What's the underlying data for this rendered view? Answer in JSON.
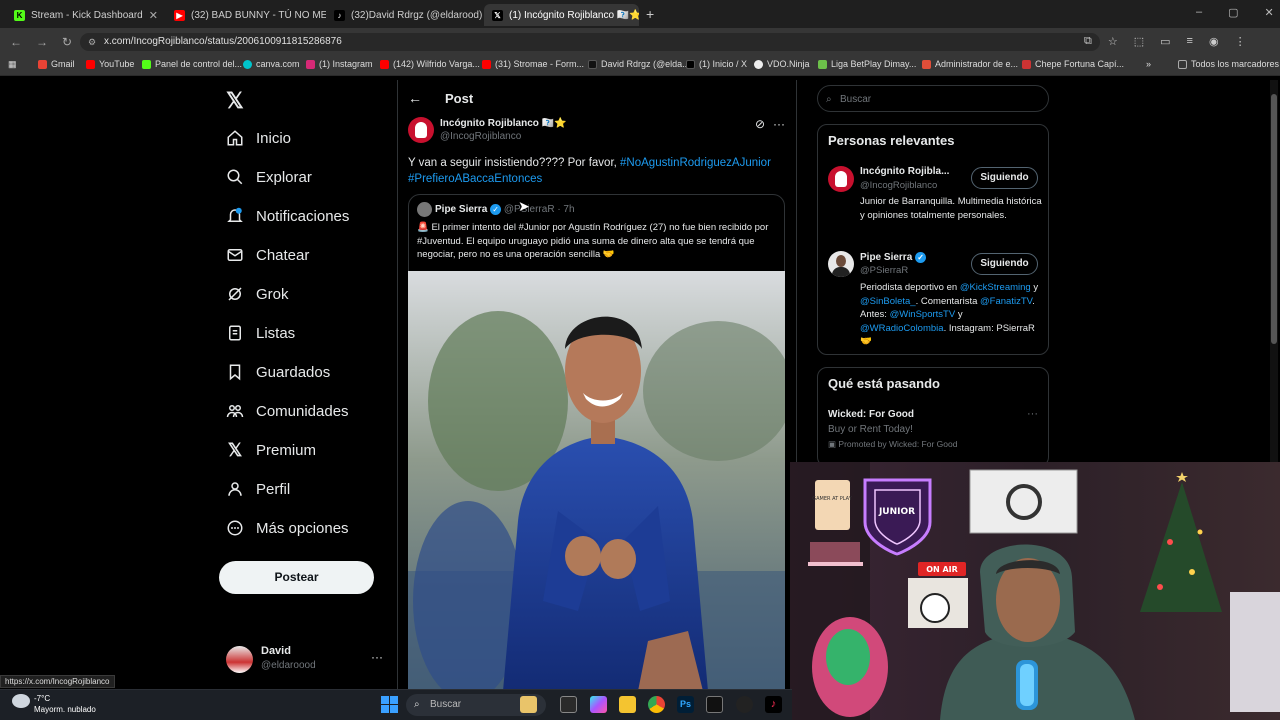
{
  "browser": {
    "tabs": [
      {
        "label": "Stream - Kick Dashboard",
        "icon": "kick-icon",
        "color": "#53fc18"
      },
      {
        "label": "(32) BAD BUNNY - TÚ NO METI",
        "icon": "youtube-icon",
        "color": "#ff0000"
      },
      {
        "label": "(32)David Rdrgz (@eldarood) |",
        "icon": "tiktok-icon",
        "color": "#ffffff"
      },
      {
        "label": "(1) Incógnito Rojiblanco 🇮🇮⭐",
        "icon": "x-icon",
        "color": "#ffffff"
      }
    ],
    "url": "x.com/IncogRojiblanco/status/2006100911815286876",
    "bookmarks": [
      "Gmail",
      "YouTube",
      "Panel de control del...",
      "canva.com",
      "(1) Instagram",
      "(142) Wilfrido Varga...",
      "(31) Stromae - Form...",
      "David Rdrgz (@elda...",
      "(1) Inicio / X",
      "VDO.Ninja",
      "Liga BetPlay Dimay...",
      "Administrador de e...",
      "Chepe Fortuna Capí..."
    ],
    "all_bookmarks": "Todos los marcadores"
  },
  "nav": {
    "items": [
      "Inicio",
      "Explorar",
      "Notificaciones",
      "Chatear",
      "Grok",
      "Listas",
      "Guardados",
      "Comunidades",
      "Premium",
      "Perfil",
      "Más opciones"
    ],
    "post_button": "Postear",
    "account": {
      "name": "David",
      "handle": "@eldaroood"
    }
  },
  "post": {
    "header": "Post",
    "author": "Incógnito Rojiblanco",
    "author_badges": "🇮🇮⭐",
    "handle": "@IncogRojiblanco",
    "text": "Y van a seguir insistiendo???? Por favor, ",
    "hashtag1": "#NoAgustinRodriguezAJunior",
    "hashtag2": "#PrefieroABaccaEntonces",
    "quote": {
      "author": "Pipe Sierra",
      "handle": "@PSierraR",
      "time": "· 7h",
      "text": "🚨 El primer intento del #Junior por Agustín Rodríguez (27) no fue bien recibido por #Juventud. El equipo uruguayo pidió una suma de dinero alta que se tendrá que negociar, pero no es una operación sencilla 🤝"
    }
  },
  "right": {
    "search_placeholder": "Buscar",
    "relevant_title": "Personas relevantes",
    "people": [
      {
        "name": "Incógnito Rojibla...",
        "handle": "@IncogRojiblanco",
        "button": "Siguiendo",
        "bio": "Junior de Barranquilla. Multimedia histórica y opiniones totalmente personales."
      },
      {
        "name": "Pipe Sierra",
        "handle": "@PSierraR",
        "button": "Siguiendo",
        "bio1": "Periodista deportivo en ",
        "bio_l1": "@KickStreaming",
        "bio2": " y ",
        "bio_l2": "@SinBoleta_",
        "bio3": ". Comentarista ",
        "bio_l3": "@FanatizTV",
        "bio4": ". Antes: ",
        "bio_l4": "@WinSportsTV",
        "bio5": " y ",
        "bio_l5": "@WRadioColombia",
        "bio6": ". Instagram: PSierraR 🤝"
      }
    ],
    "trending_title": "Qué está pasando",
    "trend": {
      "title": "Wicked: For Good",
      "subtitle": "Buy or Rent Today!",
      "promoted": "Promoted by Wicked: For Good"
    }
  },
  "webcam": {
    "sign_on_air": "ON AIR",
    "sign_gamer": "GAMER AT PLAY",
    "badge_text": "JUNIOR"
  },
  "status_link": "https://x.com/IncogRojiblanco",
  "taskbar": {
    "weather_temp": "-7°C",
    "weather_desc": "Mayorm. nublado",
    "search": "Buscar"
  }
}
